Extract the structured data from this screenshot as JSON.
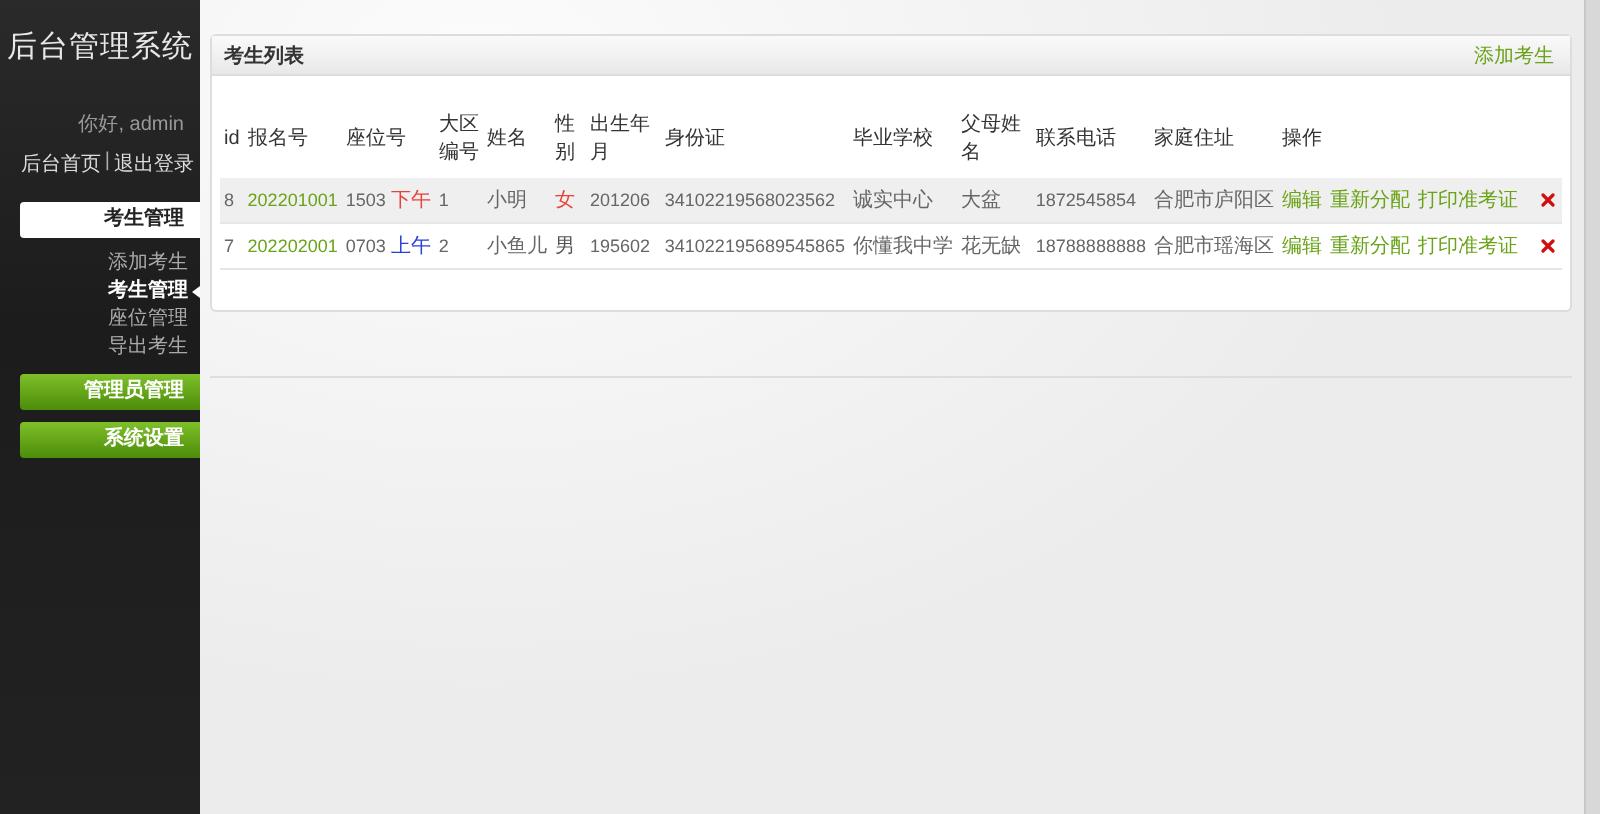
{
  "sidebar": {
    "title": "后台管理系统",
    "greeting": "你好, admin",
    "links": [
      "后台首页",
      "退出登录"
    ],
    "separator": "|",
    "menu": [
      {
        "label": "考生管理",
        "expanded": true,
        "children": [
          {
            "label": "添加考生",
            "selected": false
          },
          {
            "label": "考生管理",
            "selected": true
          },
          {
            "label": "座位管理",
            "selected": false
          },
          {
            "label": "导出考生",
            "selected": false
          }
        ]
      },
      {
        "label": "管理员管理",
        "expanded": false
      },
      {
        "label": "系统设置",
        "expanded": false
      }
    ]
  },
  "panel": {
    "title": "考生列表",
    "action": "添加考生",
    "table": {
      "columns": [
        "id",
        "报名号",
        "座位号",
        "大区编号",
        "姓名",
        "性别",
        "出生年月",
        "身份证",
        "毕业学校",
        "父母姓名",
        "联系电话",
        "家庭住址",
        "操作"
      ],
      "rows": [
        {
          "id": "8",
          "reg_no": "202201001",
          "seat": "1503",
          "session": {
            "text": "下午",
            "color": "#e8433a"
          },
          "region": "1",
          "name": "小明",
          "gender": {
            "text": "女",
            "color": "#e8433a"
          },
          "birth": "201206",
          "id_card": "34102219568023562",
          "school": "诚实中心",
          "parent": "大盆",
          "phone": "1872545854",
          "address": "合肥市庐阳区",
          "actions": [
            "编辑",
            "重新分配",
            "打印准考证"
          ]
        },
        {
          "id": "7",
          "reg_no": "202202001",
          "seat": "0703",
          "session": {
            "text": "上午",
            "color": "#2a3fd6"
          },
          "region": "2",
          "name": "小鱼儿",
          "gender": {
            "text": "男",
            "color": "#555555"
          },
          "birth": "195602",
          "id_card": "341022195689545865",
          "school": "你懂我中学",
          "parent": "花无缺",
          "phone": "18788888888",
          "address": "合肥市瑶海区",
          "actions": [
            "编辑",
            "重新分配",
            "打印准考证"
          ]
        }
      ]
    }
  }
}
